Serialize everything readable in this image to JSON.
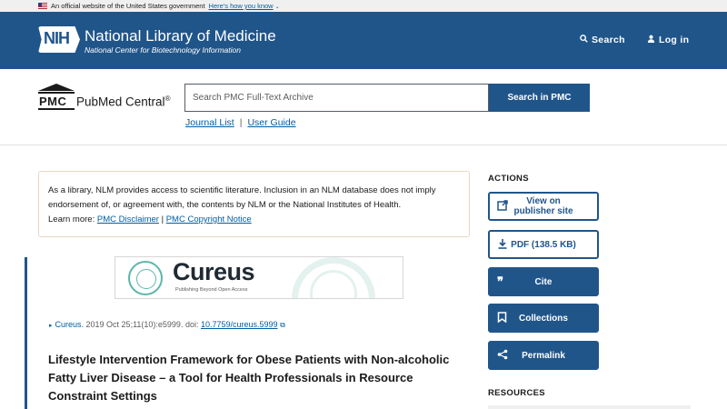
{
  "gov_banner": {
    "text": "An official website of the United States government",
    "link": "Here's how you know",
    "chevron": "⌄"
  },
  "header": {
    "badge": "NIH",
    "title": "National Library of Medicine",
    "subtitle": "National Center for Biotechnology Information",
    "search_label": "Search",
    "login_label": "Log in"
  },
  "pmc": {
    "logo_text": "PMC",
    "name": "PubMed Central",
    "registered": "®",
    "search_placeholder": "Search PMC Full-Text Archive",
    "search_button": "Search in PMC",
    "links": [
      "Journal List",
      "User Guide"
    ],
    "link_separator": "|"
  },
  "notice": {
    "line1": "As a library, NLM provides access to scientific literature. Inclusion in an NLM database does not imply",
    "line2": "endorsement of, or agreement with, the contents by NLM or the National Institutes of Health.",
    "learn_more": "Learn more:",
    "link1": "PMC Disclaimer",
    "separator": "|",
    "link2": "PMC Copyright Notice"
  },
  "journal_banner": {
    "name": "Cureus",
    "tagline": "Publishing Beyond Open Access"
  },
  "citation": {
    "journal": "Cureus",
    "details": ". 2019 Oct 25;11(10):e5999. doi: ",
    "doi": "10.7759/cureus.5999"
  },
  "article": {
    "title": "Lifestyle Intervention Framework for Obese Patients with Non-alcoholic Fatty Liver Disease – a Tool for Health Professionals in Resource Constraint Settings"
  },
  "sidebar": {
    "actions_heading": "ACTIONS",
    "actions": [
      {
        "label": "View on publisher site",
        "icon": "external-link-icon"
      },
      {
        "label": "PDF (138.5 KB)",
        "icon": "download-icon"
      },
      {
        "label": "Cite",
        "icon": "quote-icon"
      },
      {
        "label": "Collections",
        "icon": "bookmark-icon"
      },
      {
        "label": "Permalink",
        "icon": "share-icon"
      }
    ],
    "resources_heading": "RESOURCES"
  },
  "colors": {
    "brand": "#20558a",
    "link": "#005ea2",
    "notice_border": "#e8d7c3",
    "cureus_accent": "#5cb7a9"
  }
}
